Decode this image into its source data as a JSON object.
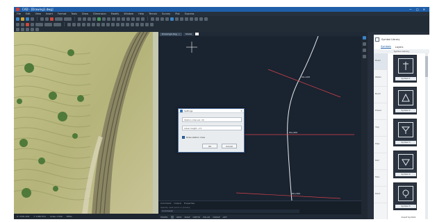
{
  "window": {
    "title": "CAD - [Drawing1.dwg]",
    "controls": [
      "—",
      "□",
      "✕"
    ]
  },
  "menu": [
    "File",
    "Edit",
    "View",
    "Insert",
    "Format",
    "Tools",
    "Draw",
    "Dimension",
    "Modify",
    "Window",
    "Help",
    "Terrain",
    "Survey",
    "Plot",
    "Express"
  ],
  "map_pane": {
    "status_items": [
      "X: 2391.204",
      "Y: 1380.551",
      "Scale 1:500",
      "EPSG"
    ]
  },
  "cad_pane": {
    "tabs": [
      {
        "label": "Drawing1.dwg",
        "active": true
      },
      {
        "label": "Model",
        "active": false
      }
    ],
    "command_tabs": [
      "Command",
      "Output",
      "Properties"
    ],
    "command_history": "Specify next point or [Undo]:",
    "command_prompt": "Command:",
    "status_items": [
      "MODEL",
      "GRID",
      "SNAP",
      "ORTHO",
      "POLAR",
      "OSNAP",
      "LWT"
    ],
    "curve_labels": [
      "K0+100",
      "K0+200",
      "K0+300"
    ]
  },
  "dialog": {
    "title": "Settings",
    "field1": "Station interval: 20",
    "field2": "Label height: 2.5",
    "checkbox_label": "Draw station lines",
    "ok_label": "OK",
    "cancel_label": "Cancel"
  },
  "library": {
    "header_label": "Symbol Library",
    "tabs": [
      "Symbols",
      "Layers"
    ],
    "subheader": "Symbol Library",
    "categories": [
      "Road",
      "Water",
      "Build",
      "Power",
      "Veg",
      "Pipe",
      "Rail",
      "Misc",
      "Point"
    ],
    "symbols": [
      "Symbol 1",
      "Symbol 2",
      "Symbol 3",
      "Symbol 4",
      "Symbol 5"
    ],
    "footer": "Insert Symbol"
  }
}
